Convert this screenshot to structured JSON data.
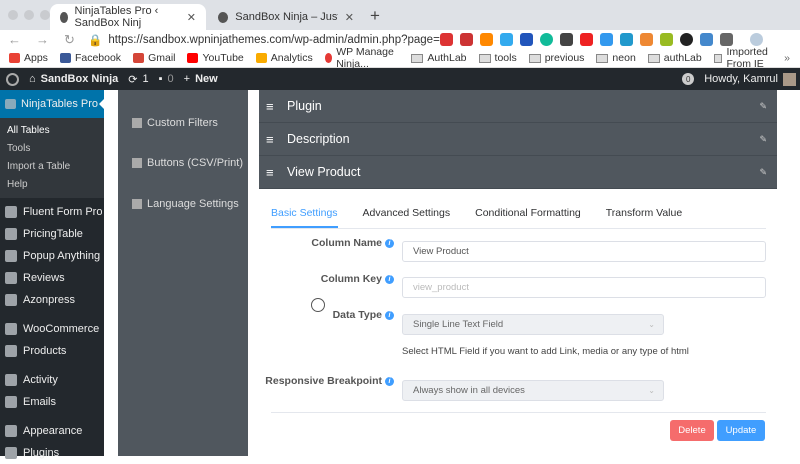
{
  "browser": {
    "tabs": [
      {
        "title": "NinjaTables Pro ‹ SandBox Ninj",
        "close": "✕"
      },
      {
        "title": "SandBox Ninja – Just a SandBo",
        "close": "✕"
      }
    ],
    "new_tab": "+",
    "url": "https://sandbox.wpninjathemes.com/wp-admin/admin.php?page=...",
    "bookmarks": [
      {
        "label": "Apps",
        "color": "#e94235"
      },
      {
        "label": "Facebook",
        "color": "#3b5998"
      },
      {
        "label": "Gmail",
        "color": "#d44638"
      },
      {
        "label": "YouTube",
        "color": "#ff0000"
      },
      {
        "label": "Analytics",
        "color": "#f9ab00"
      },
      {
        "label": "WP Manage Ninja...",
        "color": "#e53935"
      },
      {
        "label": "AuthLab",
        "folder": true
      },
      {
        "label": "tools",
        "folder": true
      },
      {
        "label": "previous",
        "folder": true
      },
      {
        "label": "neon",
        "folder": true
      },
      {
        "label": "authLab",
        "folder": true
      },
      {
        "label": "Imported From IE",
        "folder": true
      }
    ],
    "more": "»"
  },
  "adminbar": {
    "site": "SandBox Ninja",
    "updates": "1",
    "comments": "0",
    "new": "New",
    "notif": "0",
    "greeting": "Howdy, Kamrul"
  },
  "sidebar": {
    "active": "NinjaTables Pro",
    "sub": [
      "All Tables",
      "Tools",
      "Import a Table",
      "Help"
    ],
    "items": [
      "Fluent Form Pro",
      "PricingTable",
      "Popup Anything",
      "Reviews",
      "Azonpress",
      "WooCommerce",
      "Products",
      "Activity",
      "Emails",
      "Appearance",
      "Plugins"
    ]
  },
  "settings_nav": [
    "Custom Filters",
    "Buttons (CSV/Print)",
    "Language Settings"
  ],
  "columns": [
    "Plugin",
    "Description",
    "View Product"
  ],
  "tabs": [
    "Basic Settings",
    "Advanced Settings",
    "Conditional Formatting",
    "Transform Value"
  ],
  "form": {
    "column_name_label": "Column Name",
    "column_name": "View Product",
    "column_key_label": "Column Key",
    "column_key_placeholder": "view_product",
    "data_type_label": "Data Type",
    "data_type": "Single Line Text Field",
    "help": "Select HTML Field if you want to add Link, media or any type of html",
    "breakpoint_label": "Responsive Breakpoint",
    "breakpoint": "Always show in all devices"
  },
  "buttons": {
    "delete": "Delete",
    "update": "Update"
  },
  "colors": {
    "accent": "#409eff",
    "danger": "#f56c6c",
    "wp_blue": "#0073aa"
  }
}
